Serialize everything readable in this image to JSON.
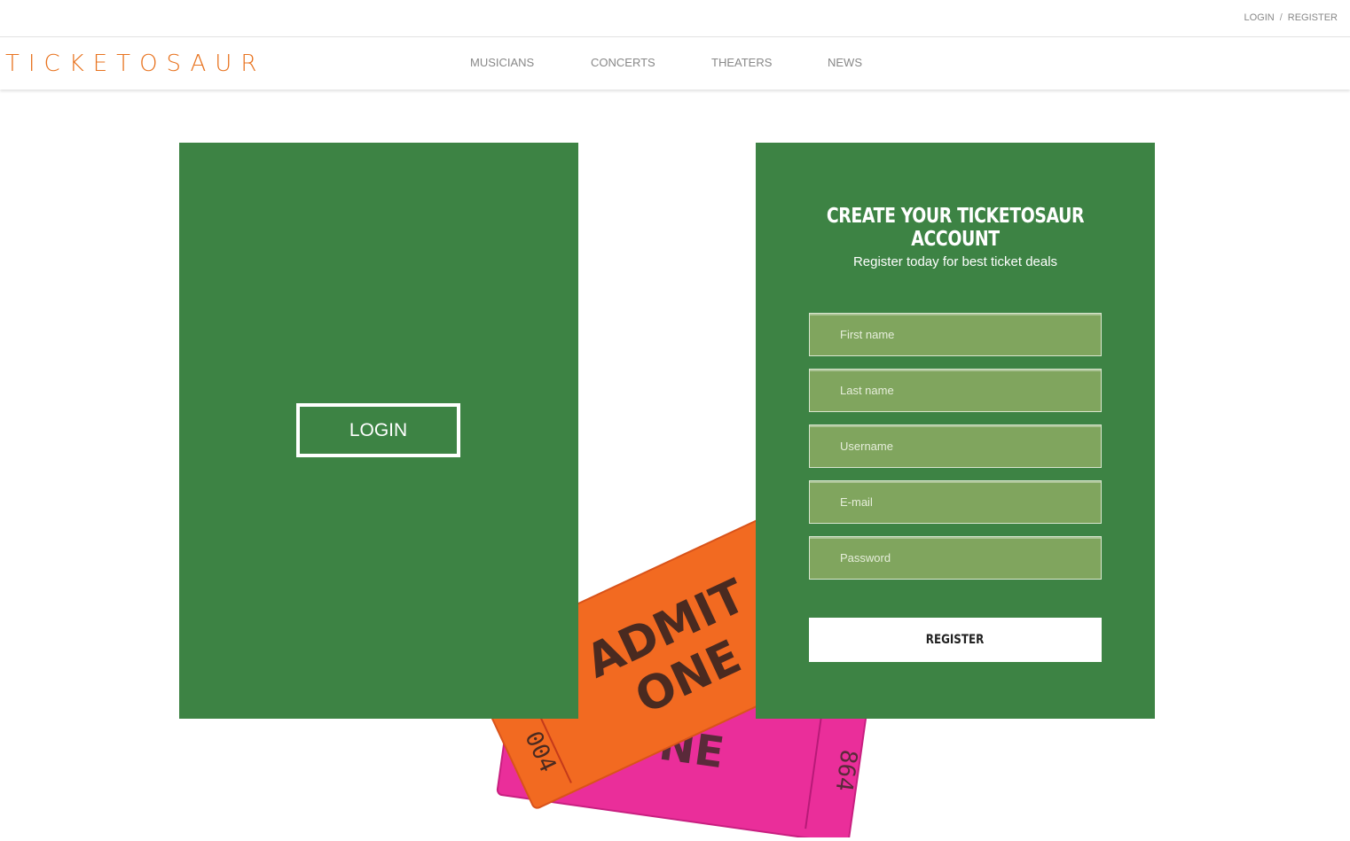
{
  "topbar": {
    "login": "LOGIN",
    "separator": "/",
    "register": "REGISTER"
  },
  "brand": {
    "logo": "TICKETOSAUR",
    "accent": "#e8731f"
  },
  "nav": {
    "items": [
      "MUSICIANS",
      "CONCERTS",
      "THEATERS",
      "NEWS"
    ]
  },
  "login_panel": {
    "button": "LOGIN",
    "bg": "#3d8344"
  },
  "register_panel": {
    "title": "CREATE YOUR TICKETOSAUR ACCOUNT",
    "subtitle": "Register today for best ticket deals",
    "fields": {
      "first_name": "First name",
      "last_name": "Last name",
      "username": "Username",
      "email": "E-mail",
      "password": "Password"
    },
    "submit": "REGISTER"
  },
  "tickets": {
    "front_line1": "ADMIT",
    "front_line2": "ONE",
    "front_number": "004",
    "back_text": "ONE",
    "back_number": "864",
    "orange": "#f26a21",
    "pink": "#ea2e9a"
  }
}
